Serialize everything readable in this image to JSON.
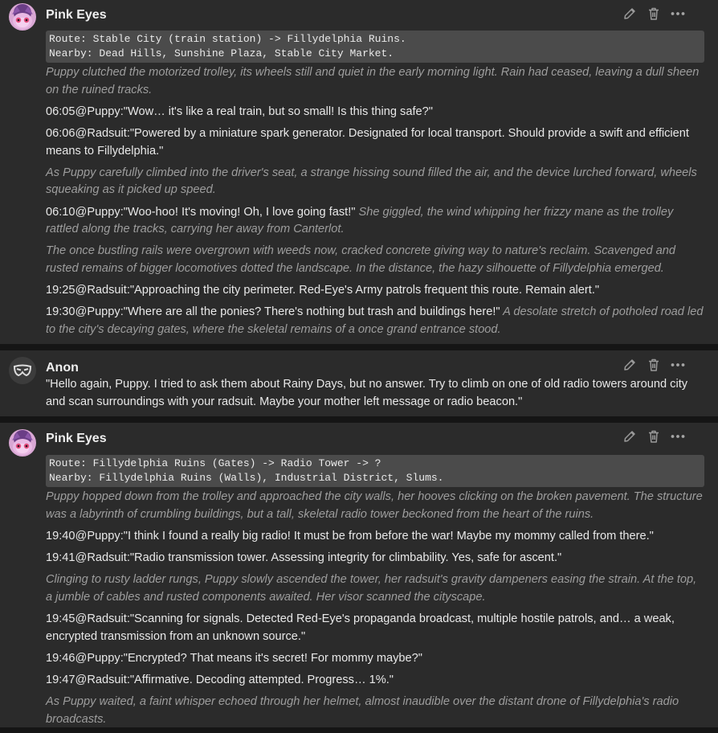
{
  "colors": {
    "background": "#151515",
    "message_bg": "#2b2b2b",
    "code_bg": "#4b4b4b",
    "narration": "#9d9d9d",
    "text": "#e8e8e8"
  },
  "icons": {
    "edit": "pencil-icon",
    "delete": "trash-icon",
    "more": "ellipsis-icon"
  },
  "messages": [
    {
      "author": "Pink Eyes",
      "code": [
        "Route: Stable City (train station) -> Fillydelphia Ruins.",
        "Nearby: Dead Hills, Sunshine Plaza, Stable City Market."
      ],
      "paragraphs": [
        {
          "narr": "Puppy clutched the motorized trolley, its wheels still and quiet in the early morning light. Rain had ceased, leaving a dull sheen on the ruined tracks."
        },
        {
          "speech": "06:05@Puppy:\"Wow… it's like a real train, but so small! Is this thing safe?\""
        },
        {
          "speech": "06:06@Radsuit:\"Powered by a miniature spark generator. Designated for local transport. Should provide a swift and efficient means to Fillydelphia.\""
        },
        {
          "narr": "As Puppy carefully climbed into the driver's seat, a strange hissing sound filled the air, and the device lurched forward, wheels squeaking as it picked up speed."
        },
        {
          "speech": "06:10@Puppy:\"Woo-hoo! It's moving! Oh, I love going fast!\"",
          "tail": " She giggled, the wind whipping her frizzy mane as the trolley rattled along the tracks, carrying her away from Canterlot."
        },
        {
          "narr": "The once bustling rails were overgrown with weeds now, cracked concrete giving way to nature's reclaim. Scavenged and rusted remains of bigger locomotives dotted the landscape. In the distance, the hazy silhouette of Fillydelphia emerged."
        },
        {
          "speech": "19:25@Radsuit:\"Approaching the city perimeter. Red-Eye's Army patrols frequent this route. Remain alert.\""
        },
        {
          "speech": "19:30@Puppy:\"Where are all the ponies? There's nothing but trash and buildings here!\"",
          "tail": " A desolate stretch of potholed road led to the city's decaying gates, where the skeletal remains of a once grand entrance stood."
        }
      ]
    },
    {
      "author": "Anon",
      "paragraphs": [
        {
          "speech": "\"Hello again, Puppy. I tried to ask them about Rainy Days, but no answer. Try to climb on one of old radio towers around city and scan surroundings with your radsuit. Maybe your mother left message or radio beacon.\""
        }
      ]
    },
    {
      "author": "Pink Eyes",
      "code": [
        "Route: Fillydelphia Ruins (Gates) -> Radio Tower -> ?",
        "Nearby: Fillydelphia Ruins (Walls), Industrial District, Slums."
      ],
      "paragraphs": [
        {
          "narr": "Puppy hopped down from the trolley and approached the city walls, her hooves clicking on the broken pavement. The structure was a labyrinth of crumbling buildings, but a tall, skeletal radio tower beckoned from the heart of the ruins."
        },
        {
          "speech": "19:40@Puppy:\"I think I found a really big radio! It must be from before the war! Maybe my mommy called from there.\""
        },
        {
          "speech": "19:41@Radsuit:\"Radio transmission tower. Assessing integrity for climbability. Yes, safe for ascent.\""
        },
        {
          "narr": "Clinging to rusty ladder rungs, Puppy slowly ascended the tower, her radsuit's gravity dampeners easing the strain. At the top, a jumble of cables and rusted components awaited. Her visor scanned the cityscape."
        },
        {
          "speech": "19:45@Radsuit:\"Scanning for signals. Detected Red-Eye's propaganda broadcast, multiple hostile patrols, and… a weak, encrypted transmission from an unknown source.\""
        },
        {
          "speech": "19:46@Puppy:\"Encrypted? That means it's secret! For mommy maybe?\""
        },
        {
          "speech": "19:47@Radsuit:\"Affirmative. Decoding attempted. Progress… 1%.\""
        },
        {
          "narr": "As Puppy waited, a faint whisper echoed through her helmet, almost inaudible over the distant drone of Fillydelphia's radio broadcasts."
        }
      ]
    }
  ]
}
